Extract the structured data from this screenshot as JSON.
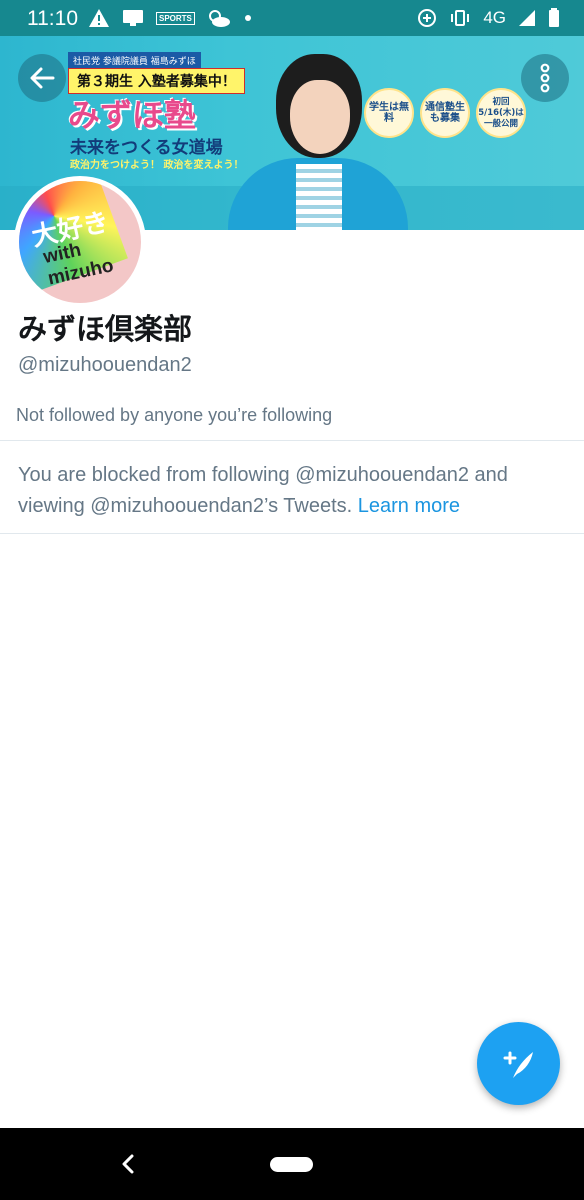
{
  "status_bar": {
    "time": "11:10",
    "left_icons": [
      "warning-icon",
      "desktop-icon",
      "news-app-icon",
      "weather-icon",
      "dot-icon"
    ],
    "right_icons": [
      "data-saver-icon",
      "vibrate-icon",
      "network-icon",
      "signal-icon",
      "battery-icon"
    ],
    "network_label": "4G",
    "news_label": "SPORTS"
  },
  "banner": {
    "party_line": "社民党 参議院議員 福島みずほ",
    "recruit": "第３期生 入塾者募集中！",
    "title": "みずほ塾",
    "subtitle": "未来をつくる女道場",
    "slogan": "政治力をつけよう！ 政治を変えよう！",
    "circle_1": "学生は無料",
    "circle_2": "通信塾生も募集",
    "circle_3": "初回 5/16(木)は 一般公開"
  },
  "avatar": {
    "text_top": "大好き",
    "text_bottom": "with mizuho"
  },
  "profile": {
    "name": "みずほ倶楽部",
    "handle": "@mizuhoouendan2",
    "followed_by": "Not followed by anyone you’re following"
  },
  "blocked_notice": {
    "text": "You are blocked from following @mizuhoouendan2 and viewing @mizuhoouendan2’s Tweets. ",
    "link": "Learn more"
  },
  "colors": {
    "accent": "#1da1f2",
    "status_bar": "#16888f",
    "link": "#1b95e0",
    "secondary_text": "#657786"
  }
}
